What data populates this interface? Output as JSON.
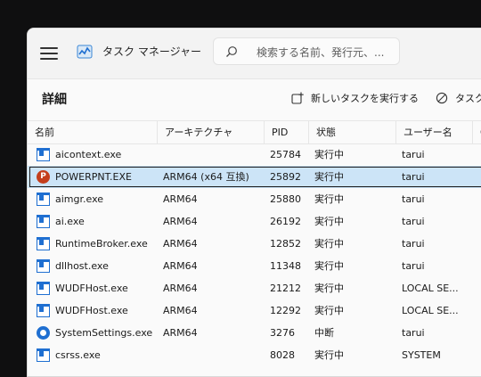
{
  "app": {
    "title": "タスク マネージャー"
  },
  "search": {
    "placeholder": "検索する名前、発行元、..."
  },
  "page": {
    "title": "詳細"
  },
  "toolbar": {
    "new_task_label": "新しいタスクを実行する",
    "end_task_label": "タスク"
  },
  "table": {
    "columns": [
      "名前",
      "アーキテクチャ",
      "PID",
      "状態",
      "ユーザー名",
      "C"
    ],
    "rows": [
      {
        "name": "aicontext.exe",
        "arch": "",
        "pid": "25784",
        "status": "実行中",
        "user": "tarui",
        "icon": "exe-icon"
      },
      {
        "name": "POWERPNT.EXE",
        "arch": "ARM64 (x64 互換)",
        "pid": "25892",
        "status": "実行中",
        "user": "tarui",
        "icon": "powerpoint-icon"
      },
      {
        "name": "aimgr.exe",
        "arch": "ARM64",
        "pid": "25880",
        "status": "実行中",
        "user": "tarui",
        "icon": "exe-icon"
      },
      {
        "name": "ai.exe",
        "arch": "ARM64",
        "pid": "26192",
        "status": "実行中",
        "user": "tarui",
        "icon": "exe-icon"
      },
      {
        "name": "RuntimeBroker.exe",
        "arch": "ARM64",
        "pid": "12852",
        "status": "実行中",
        "user": "tarui",
        "icon": "exe-icon"
      },
      {
        "name": "dllhost.exe",
        "arch": "ARM64",
        "pid": "11348",
        "status": "実行中",
        "user": "tarui",
        "icon": "exe-icon"
      },
      {
        "name": "WUDFHost.exe",
        "arch": "ARM64",
        "pid": "21212",
        "status": "実行中",
        "user": "LOCAL SE...",
        "icon": "exe-icon"
      },
      {
        "name": "WUDFHost.exe",
        "arch": "ARM64",
        "pid": "12292",
        "status": "実行中",
        "user": "LOCAL SE...",
        "icon": "exe-icon"
      },
      {
        "name": "SystemSettings.exe",
        "arch": "ARM64",
        "pid": "3276",
        "status": "中断",
        "user": "tarui",
        "icon": "settings-gear-icon"
      },
      {
        "name": "csrss.exe",
        "arch": "",
        "pid": "8028",
        "status": "実行中",
        "user": "SYSTEM",
        "icon": "exe-icon"
      }
    ],
    "selected_row": 1
  },
  "colors": {
    "window_bg": "#f3f3f3",
    "selection": "#cce4f7",
    "accent": "#1f6fd1"
  }
}
